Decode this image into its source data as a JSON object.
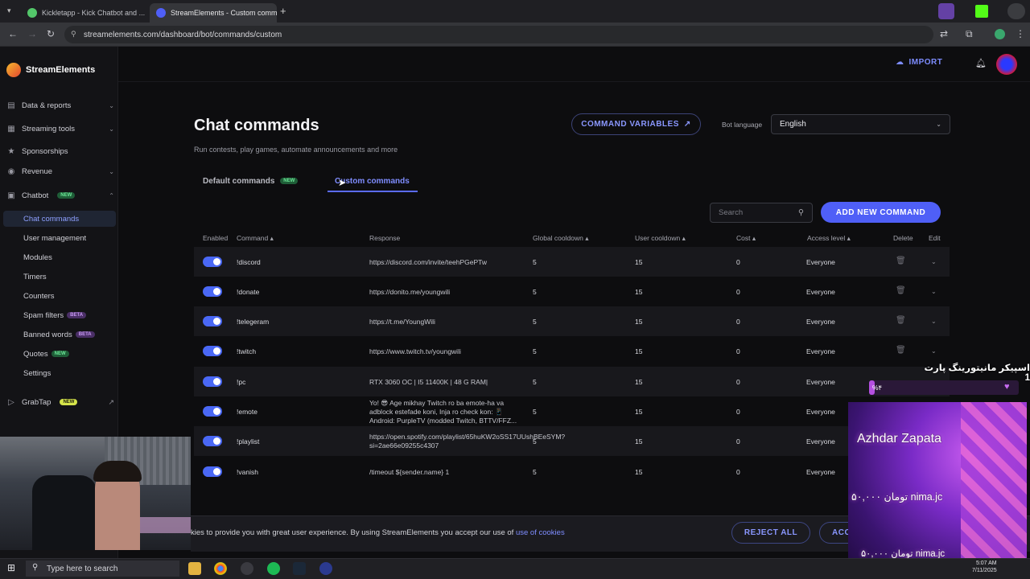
{
  "browser": {
    "tabs": [
      {
        "title": "Kickletapp - Kick Chatbot and ..."
      },
      {
        "title": "StreamElements - Custom comm..."
      }
    ],
    "url": "streamelements.com/dashboard/bot/commands/custom"
  },
  "sidebar": {
    "brand": "StreamElements",
    "items": [
      {
        "label": "Data & reports",
        "icon": "chart-icon"
      },
      {
        "label": "Streaming tools",
        "icon": "tools-icon"
      },
      {
        "label": "Sponsorships",
        "icon": "star-icon"
      },
      {
        "label": "Revenue",
        "icon": "revenue-icon"
      },
      {
        "label": "Chatbot",
        "icon": "chatbot-icon",
        "badge": "NEW"
      }
    ],
    "chatbot_subitems": [
      {
        "label": "Chat commands"
      },
      {
        "label": "User management"
      },
      {
        "label": "Modules"
      },
      {
        "label": "Timers"
      },
      {
        "label": "Counters"
      },
      {
        "label": "Spam filters",
        "badge": "BETA"
      },
      {
        "label": "Banned words",
        "badge": "BETA"
      },
      {
        "label": "Quotes",
        "badge": "NEW"
      },
      {
        "label": "Settings"
      }
    ],
    "grabtap": {
      "label": "GrabTap",
      "badge": "NEW"
    }
  },
  "header": {
    "import_label": "IMPORT"
  },
  "main": {
    "title": "Chat commands",
    "subtitle": "Run contests, play games, automate announcements and more",
    "command_variables_label": "COMMAND VARIABLES",
    "bot_language_label": "Bot language",
    "bot_language_value": "English",
    "tabs": [
      {
        "label": "Default commands",
        "badge": "NEW"
      },
      {
        "label": "Custom commands"
      }
    ],
    "search_placeholder": "Search",
    "add_button_label": "ADD NEW COMMAND",
    "columns": [
      "Enabled",
      "Command",
      "Response",
      "Global cooldown",
      "User cooldown",
      "Cost",
      "Access level",
      "Delete",
      "Edit"
    ],
    "rows": [
      {
        "command": "!discord",
        "response": "https://discord.com/invite/teehPGePTw",
        "global": "5",
        "user": "15",
        "cost": "0",
        "access": "Everyone"
      },
      {
        "command": "!donate",
        "response": "https://donito.me/youngwili",
        "global": "5",
        "user": "15",
        "cost": "0",
        "access": "Everyone"
      },
      {
        "command": "!telegeram",
        "response": "https://t.me/YoungWili",
        "global": "5",
        "user": "15",
        "cost": "0",
        "access": "Everyone"
      },
      {
        "command": "!twitch",
        "response": "https://www.twitch.tv/youngwili",
        "global": "5",
        "user": "15",
        "cost": "0",
        "access": "Everyone"
      },
      {
        "command": "!pc",
        "response": "RTX 3060 OC | I5 11400K | 48 G RAM|",
        "global": "5",
        "user": "15",
        "cost": "0",
        "access": "Everyone"
      },
      {
        "command": "!emote",
        "response": "Yo! 😎 Age mikhay Twitch ro ba emote-ha va adblock estefade koni, Inja ro check kon: 📱 Android: PurpleTV (modded Twitch, BTTV/FFZ...",
        "global": "5",
        "user": "15",
        "cost": "0",
        "access": "Everyone"
      },
      {
        "command": "!playlist",
        "response": "https://open.spotify.com/playlist/65huKW2oSS17UUshBEeSYM?si=2ae66e09255c4307",
        "global": "5",
        "user": "15",
        "cost": "0",
        "access": "Everyone"
      },
      {
        "command": "!vanish",
        "response": "/timeout ${sender.name} 1",
        "global": "5",
        "user": "15",
        "cost": "0",
        "access": "Everyone"
      }
    ]
  },
  "cookie": {
    "text": "kies to provide you with great user experience. By using StreamElements you accept our use of ",
    "link": "use of cookies",
    "reject_label": "REJECT ALL",
    "accept_label": "ACCEPT ALL"
  },
  "overlay": {
    "title": "اسپیکر مانیتورینگ پارت 1",
    "progress_label": "%۴",
    "progress_fraction": 0.04,
    "name": "Azhdar Zapata",
    "donation_1": "۵۰,۰۰۰ تومان  nima.jc",
    "donation_2": "۵۰,۰۰۰ تومان  nima.jc"
  },
  "taskbar": {
    "search_placeholder": "Type here to search",
    "time": "5:07 AM",
    "date": "7/11/2025"
  },
  "colors": {
    "accent": "#4f5ff7",
    "link": "#7f8dff",
    "background": "#0d0d0f"
  }
}
